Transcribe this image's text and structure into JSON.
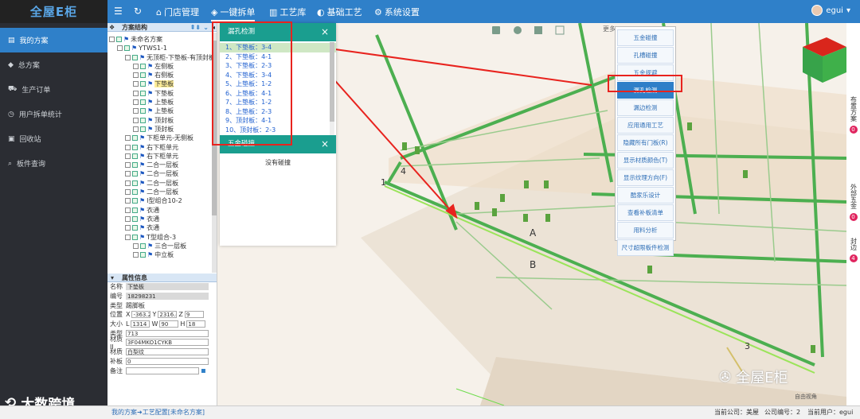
{
  "app": {
    "logo": "全屋E柜"
  },
  "topnav": {
    "items": [
      "门店管理",
      "一键拆单",
      "工艺库",
      "基础工艺",
      "系统设置"
    ],
    "active": 1
  },
  "user": {
    "name": "egui"
  },
  "sidebar": {
    "items": [
      {
        "label": "我的方案",
        "icon": "home-icon",
        "active": true
      },
      {
        "label": "总方案",
        "icon": "diamond-icon"
      },
      {
        "label": "生产订单",
        "icon": "cart-icon"
      },
      {
        "label": "用户拆单统计",
        "icon": "clock-icon"
      },
      {
        "label": "回收站",
        "icon": "trash-icon"
      },
      {
        "label": "板件查询",
        "icon": "search-icon"
      }
    ]
  },
  "watermark_left": "大数跨境",
  "tree": {
    "title": "方案结构",
    "rows": [
      {
        "i": 0,
        "t": "未命名方案"
      },
      {
        "i": 1,
        "t": "YTWS1-1"
      },
      {
        "i": 2,
        "t": "无顶柜-下垫板-有顶封板"
      },
      {
        "i": 3,
        "t": "左侧板"
      },
      {
        "i": 3,
        "t": "右侧板"
      },
      {
        "i": 3,
        "t": "下垫板",
        "hl": true
      },
      {
        "i": 3,
        "t": "下垫板"
      },
      {
        "i": 3,
        "t": "上垫板"
      },
      {
        "i": 3,
        "t": "上垫板"
      },
      {
        "i": 3,
        "t": "顶封板"
      },
      {
        "i": 3,
        "t": "顶封板"
      },
      {
        "i": 2,
        "t": "下柜单元-无侧板"
      },
      {
        "i": 2,
        "t": "右下柜单元"
      },
      {
        "i": 2,
        "t": "右下柜单元"
      },
      {
        "i": 2,
        "t": "二合一层板"
      },
      {
        "i": 2,
        "t": "二合一层板"
      },
      {
        "i": 2,
        "t": "二合一层板"
      },
      {
        "i": 2,
        "t": "二合一层板"
      },
      {
        "i": 2,
        "t": "I型组合10-2"
      },
      {
        "i": 2,
        "t": "衣通"
      },
      {
        "i": 2,
        "t": "衣通"
      },
      {
        "i": 2,
        "t": "衣通"
      },
      {
        "i": 2,
        "t": "T型组合-3"
      },
      {
        "i": 3,
        "t": "三合一层板"
      },
      {
        "i": 3,
        "t": "中立板"
      }
    ]
  },
  "props": {
    "title": "属性信息",
    "name_label": "名称",
    "name": "下垫板",
    "code_label": "编号",
    "code": "18298231",
    "type_label": "类型",
    "type": "踢脚板",
    "pos_label": "位置",
    "px": "-363.2",
    "py": "2316.4",
    "pz": "9",
    "size_label": "大小",
    "sl": "1314",
    "sw": "90",
    "sh": "18",
    "kind_label": "类型",
    "kind": "713",
    "mat_label": "材质II",
    "mat": "3F04MKO1CYKB",
    "tex_label": "材质",
    "tex": "白梨纹",
    "edge_label": "补板",
    "edge": "0",
    "note_label": "备注",
    "note": ""
  },
  "hole_panel": {
    "title": "漏孔检测",
    "items": [
      "1、下垫板：3-4",
      "2、下垫板：4-1",
      "3、下垫板：2-3",
      "4、下垫板：3-4",
      "5、上垫板：1-2",
      "6、上垫板：4-1",
      "7、上垫板：1-2",
      "8、上垫板：2-3",
      "9、顶封板：4-1",
      "10、顶封板：2-3"
    ],
    "collide_title": "五金碰撞",
    "collide_empty": "没有碰撞"
  },
  "menu": {
    "more": "更多",
    "items": [
      "五金碰撞",
      "孔槽碰撞",
      "五金规避",
      "漏孔检测",
      "漏边检测",
      "应用通用工艺",
      "隐藏所有门板(R)",
      "显示材质颜色(T)",
      "显示纹理方向(F)",
      "酷家乐设计",
      "查看补板清单",
      "用料分析",
      "尺寸超限板件检测"
    ],
    "selected": 3
  },
  "viewport": {
    "labels": [
      "1",
      "4",
      "A",
      "B",
      "3"
    ],
    "view_label": "自由视角",
    "wechat": "全屋E柜"
  },
  "rightbar": [
    {
      "label": "布置方案",
      "count": "0"
    },
    {
      "label": "外部五金",
      "count": "0"
    },
    {
      "label": "封边",
      "count": "4"
    }
  ],
  "status": {
    "breadcrumb1": "我的方案",
    "breadcrumb2": "工艺配置[未命名方案]",
    "company": "当前公司：美屋",
    "company_no": "公司编号：2",
    "current_user": "当前用户：egui"
  },
  "colors": {
    "accent": "#2f80c9",
    "teal": "#1a9e8f",
    "annotation": "#e8231e"
  }
}
